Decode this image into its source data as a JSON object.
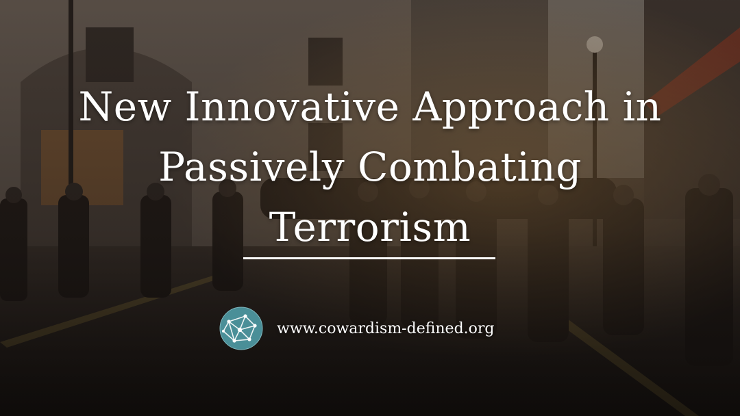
{
  "banner": {
    "title": "New Innovative Approach in Passively Combating Terrorism",
    "url": "www.cowardism-defined.org"
  },
  "background": {
    "description_icon": "busy-city-street-photo",
    "tint_color": "#14100e"
  },
  "logo": {
    "icon": "network-globe-icon",
    "fill_color": "#4a8f98",
    "line_color": "#ffffff"
  },
  "colors": {
    "text": "#ffffff",
    "rule": "#ffffff"
  }
}
